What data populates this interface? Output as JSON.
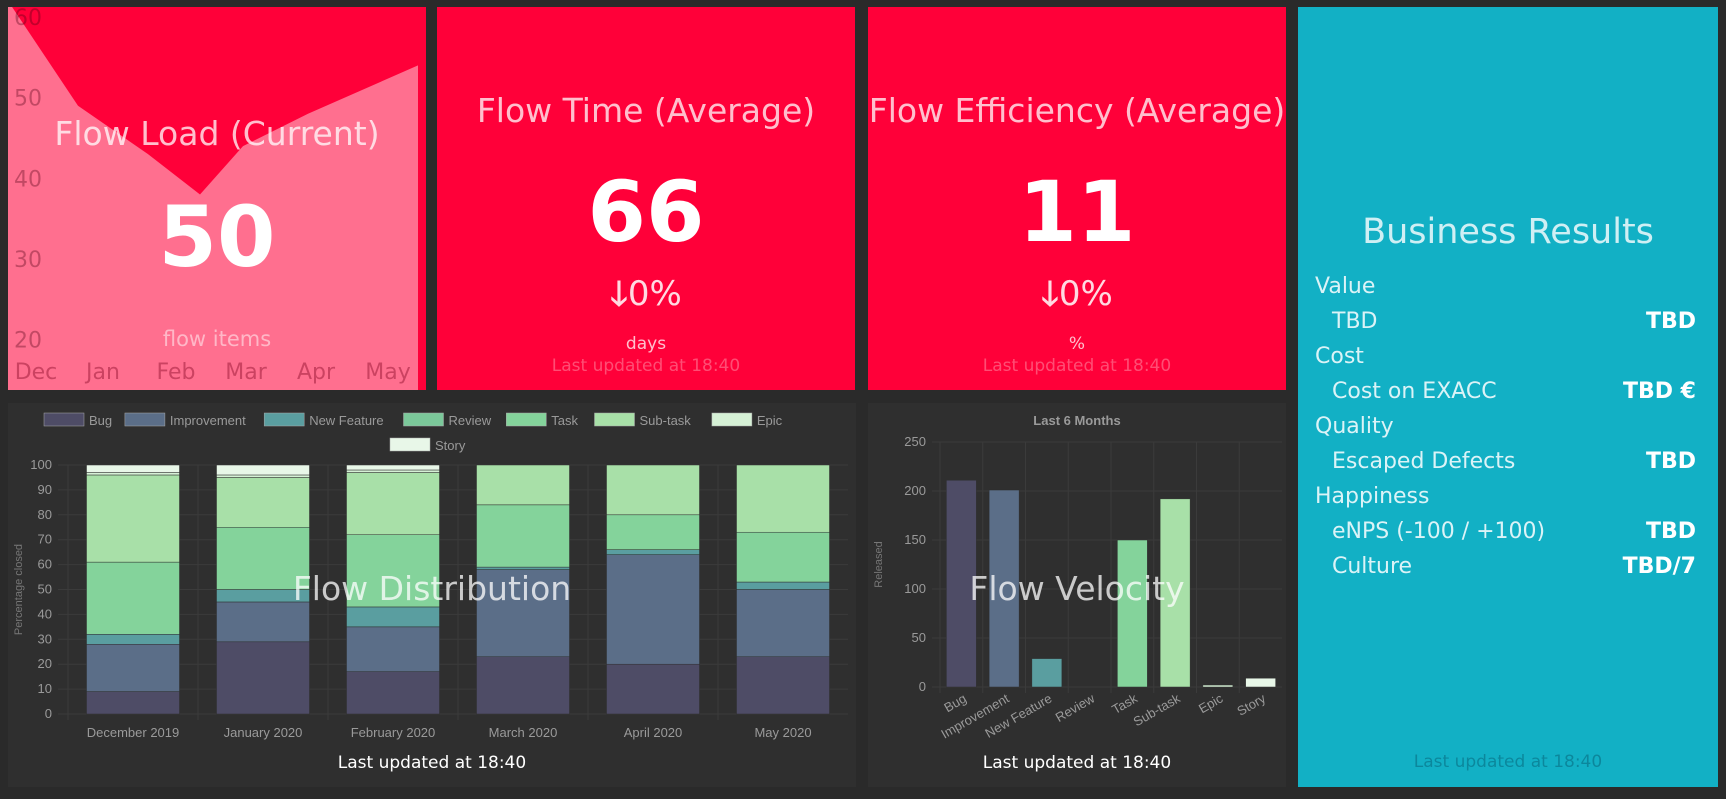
{
  "flow_load": {
    "title": "Flow Load (Current)",
    "value": "50",
    "unit": "flow items"
  },
  "flow_time": {
    "title": "Flow Time (Average)",
    "value": "66",
    "change": "0%",
    "unit": "days",
    "updated": "Last updated at 18:40"
  },
  "flow_efficiency": {
    "title": "Flow Efficiency (Average)",
    "value": "11",
    "change": "0%",
    "unit": "%",
    "updated": "Last updated at 18:40"
  },
  "business": {
    "title": "Business Results",
    "categories": [
      {
        "name": "Value",
        "rows": [
          {
            "label": "TBD",
            "value": "TBD"
          }
        ]
      },
      {
        "name": "Cost",
        "rows": [
          {
            "label": "Cost on EXACC",
            "value": "TBD €"
          }
        ]
      },
      {
        "name": "Quality",
        "rows": [
          {
            "label": "Escaped Defects",
            "value": "TBD"
          }
        ]
      },
      {
        "name": "Happiness",
        "rows": [
          {
            "label": "eNPS (-100 / +100)",
            "value": "TBD"
          },
          {
            "label": "Culture",
            "value": "TBD/7"
          }
        ]
      }
    ],
    "updated": "Last updated at 18:40"
  },
  "flow_distribution": {
    "title": "Flow Distribution",
    "updated": "Last updated at 18:40"
  },
  "flow_velocity": {
    "title": "Flow Velocity",
    "updated": "Last updated at 18:40"
  },
  "colors": {
    "Bug": "#4e4c66",
    "Improvement": "#5b6e88",
    "New Feature": "#5a9ea0",
    "Review": "#7bc89a",
    "Task": "#84d39b",
    "Sub-task": "#a8e0a8",
    "Epic": "#d6f1d6",
    "Story": "#e8f7e8"
  },
  "chart_data": [
    {
      "type": "area",
      "x": [
        "Dec",
        "Jan",
        "Feb",
        "Mar",
        "Apr",
        "May"
      ],
      "values": [
        62,
        49,
        43,
        38,
        44,
        48,
        54
      ],
      "ylim": [
        15,
        60
      ],
      "yticks": [
        20,
        30,
        40,
        50,
        60
      ]
    },
    {
      "type": "bar",
      "stacked": true,
      "categories": [
        "December 2019",
        "January 2020",
        "February 2020",
        "March 2020",
        "April 2020",
        "May 2020"
      ],
      "ylabel": "Percentage closed",
      "ylim": [
        0,
        100
      ],
      "yticks": [
        0,
        10,
        20,
        30,
        40,
        50,
        60,
        70,
        80,
        90,
        100
      ],
      "legend_position": "top",
      "series": [
        {
          "name": "Bug",
          "values": [
            9,
            29,
            17,
            23,
            20,
            23
          ]
        },
        {
          "name": "Improvement",
          "values": [
            19,
            16,
            18,
            35,
            44,
            27
          ]
        },
        {
          "name": "New Feature",
          "values": [
            4,
            5,
            8,
            1,
            2,
            3
          ]
        },
        {
          "name": "Review",
          "values": [
            0,
            0,
            0,
            0,
            0,
            0
          ]
        },
        {
          "name": "Task",
          "values": [
            29,
            25,
            29,
            25,
            14,
            20
          ]
        },
        {
          "name": "Sub-task",
          "values": [
            35,
            20,
            25,
            16,
            20,
            27
          ]
        },
        {
          "name": "Epic",
          "values": [
            1,
            1,
            1,
            0,
            0,
            0
          ]
        },
        {
          "name": "Story",
          "values": [
            3,
            4,
            2,
            0,
            0,
            0
          ]
        }
      ]
    },
    {
      "type": "bar",
      "title": "Last 6 Months",
      "ylabel": "Released",
      "ylim": [
        0,
        250
      ],
      "yticks": [
        0,
        50,
        100,
        150,
        200,
        250
      ],
      "categories": [
        "Bug",
        "Improvement",
        "New Feature",
        "Review",
        "Task",
        "Sub-task",
        "Epic",
        "Story"
      ],
      "values": [
        211,
        201,
        29,
        0,
        150,
        192,
        2,
        9
      ]
    }
  ]
}
